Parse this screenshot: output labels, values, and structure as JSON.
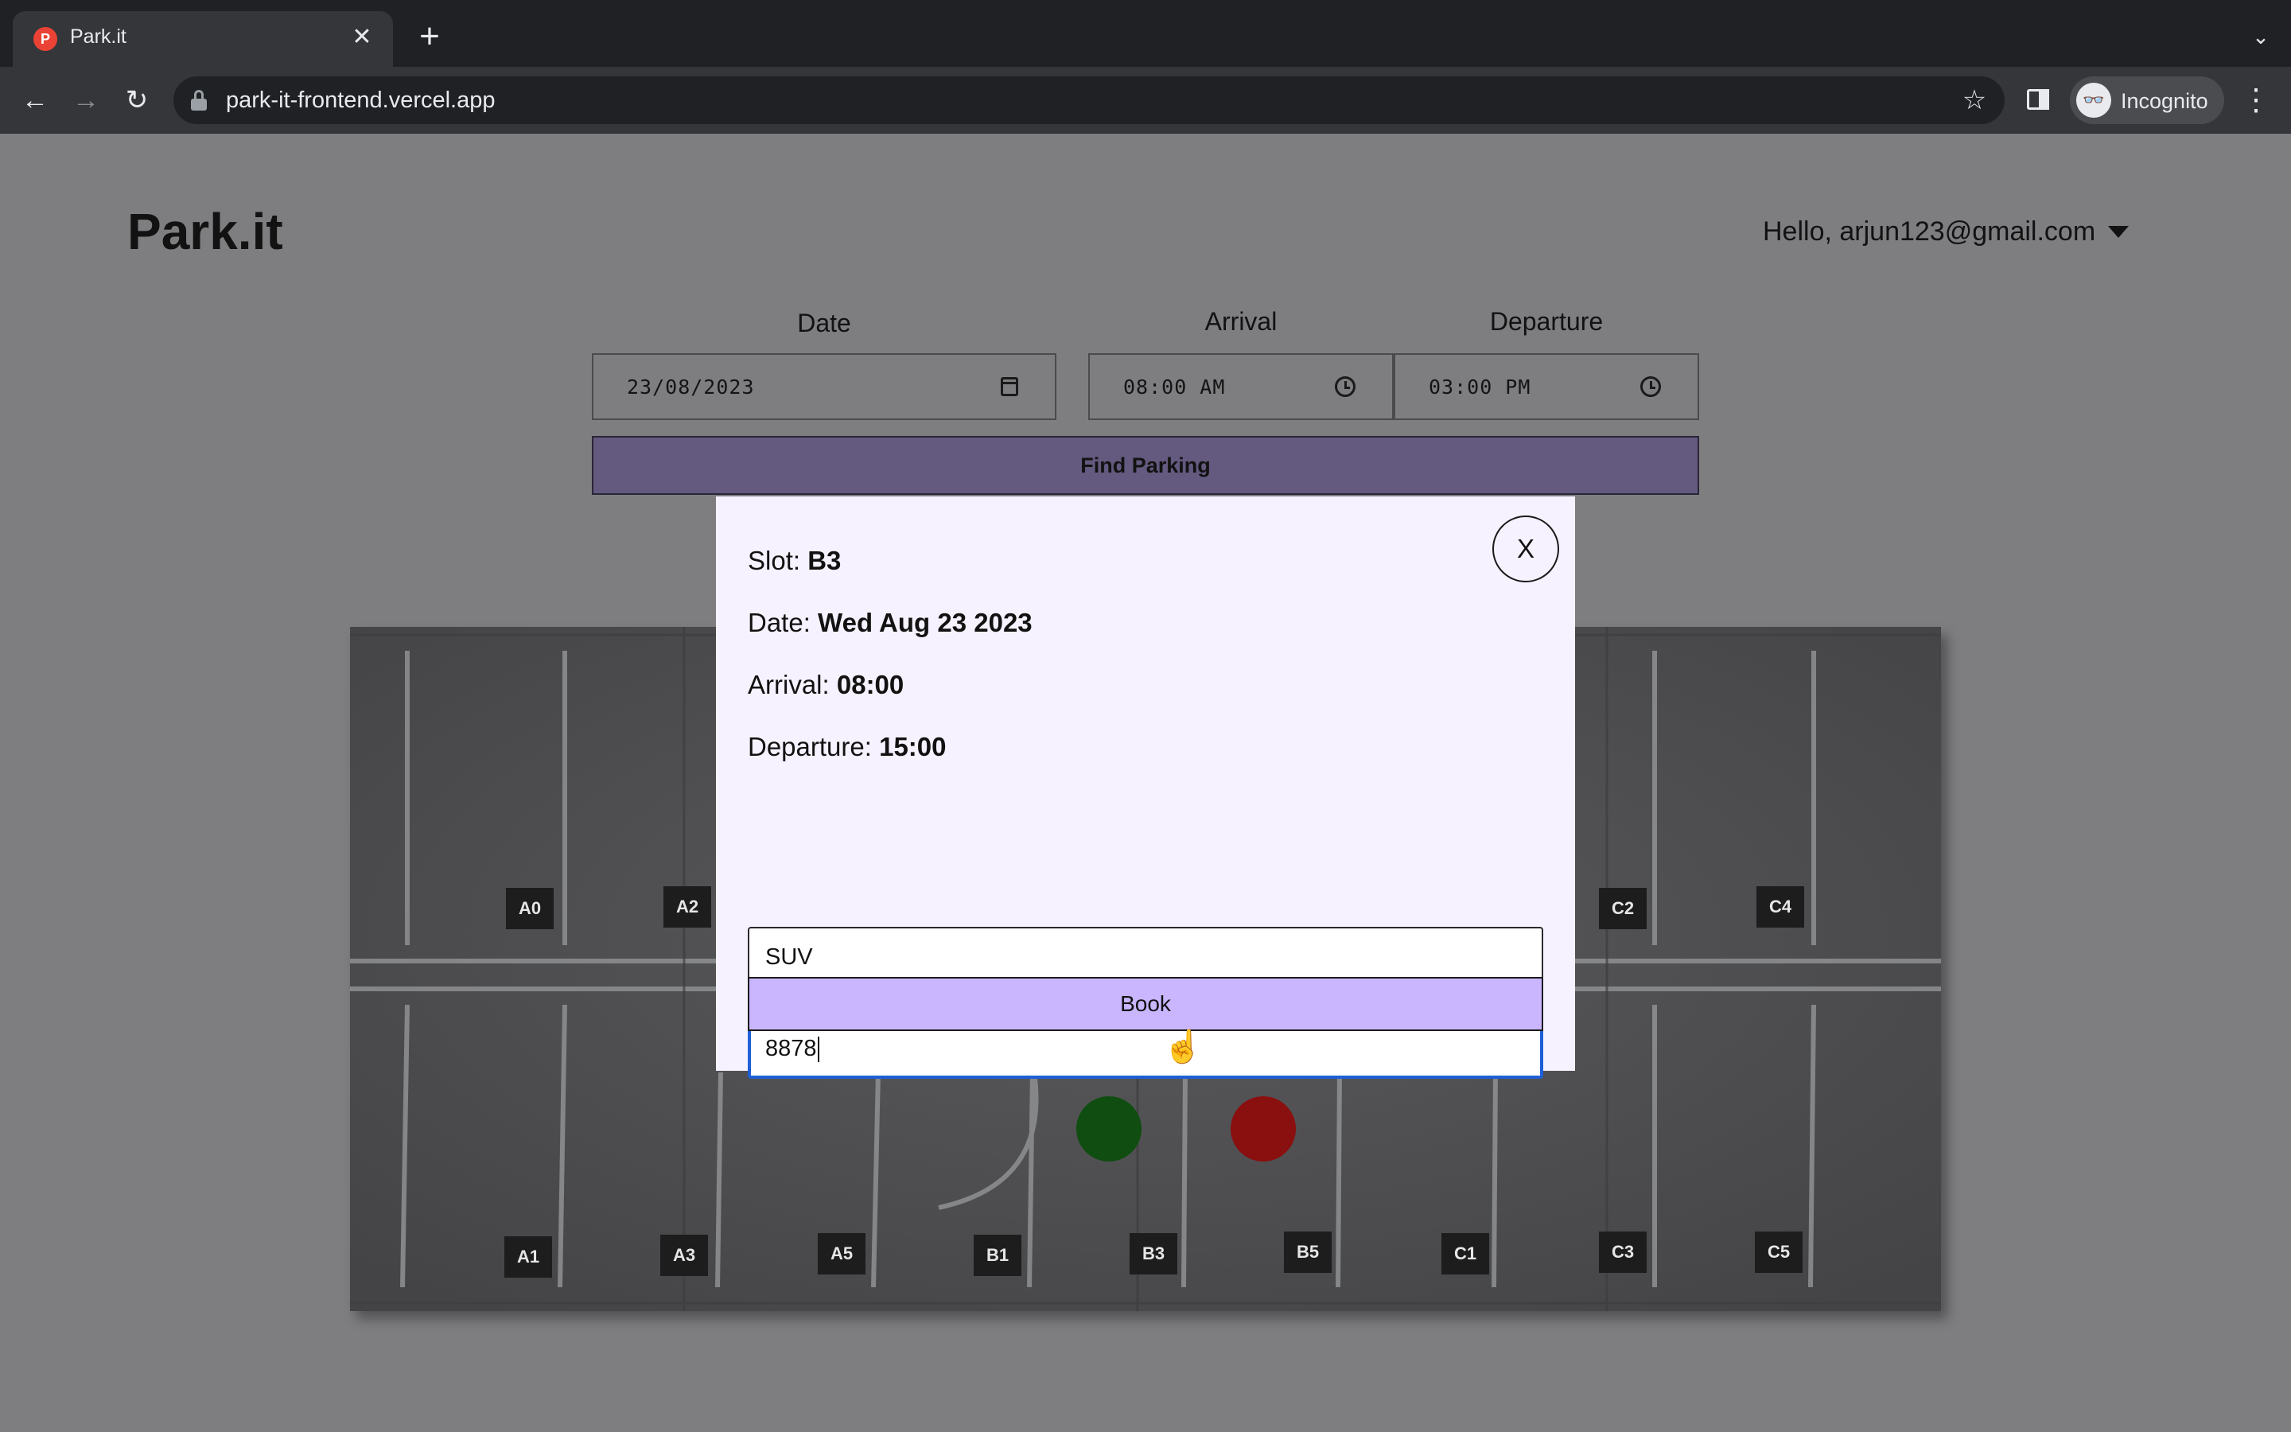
{
  "browser": {
    "tab_title": "Park.it",
    "tab_favicon": "P",
    "close_tab_glyph": "✕",
    "new_tab_glyph": "+",
    "tab_search_glyph": "⌄",
    "back_glyph": "←",
    "forward_glyph": "→",
    "reload_glyph": "↻",
    "url": "park-it-frontend.vercel.app",
    "star_glyph": "☆",
    "incognito_glyph": "👓",
    "incognito_label": "Incognito",
    "menu_glyph": "⋮"
  },
  "header": {
    "brand": "Park.it",
    "greeting": "Hello, arjun123@gmail.com"
  },
  "search_form": {
    "date_label": "Date",
    "date_value": "23/08/2023",
    "arrival_label": "Arrival",
    "arrival_value": "08:00 AM",
    "departure_label": "Departure",
    "departure_value": "03:00 PM",
    "submit_label": "Find Parking"
  },
  "lot": {
    "slots": [
      "A0",
      "A2",
      "C2",
      "C4",
      "A1",
      "A3",
      "A5",
      "B1",
      "B3",
      "B5",
      "C1",
      "C3",
      "C5"
    ],
    "indicators": [
      {
        "color": "#0f4d10",
        "status": "available"
      },
      {
        "color": "#8a0f0f",
        "status": "occupied"
      }
    ]
  },
  "modal": {
    "close_label": "X",
    "slot_label": "Slot:",
    "slot_value": "B3",
    "date_label": "Date:",
    "date_value": "Wed Aug 23 2023",
    "arrival_label": "Arrival:",
    "arrival_value": "08:00",
    "departure_label": "Departure:",
    "departure_value": "15:00",
    "vehicle_type_value": "SUV",
    "vehicle_number_value": "8878",
    "book_label": "Book"
  },
  "colors": {
    "accent_button": "#c9b6ff",
    "find_button": "#64597f",
    "modal_bg": "#f6f2ff",
    "focus_ring": "#1f5fd6"
  }
}
